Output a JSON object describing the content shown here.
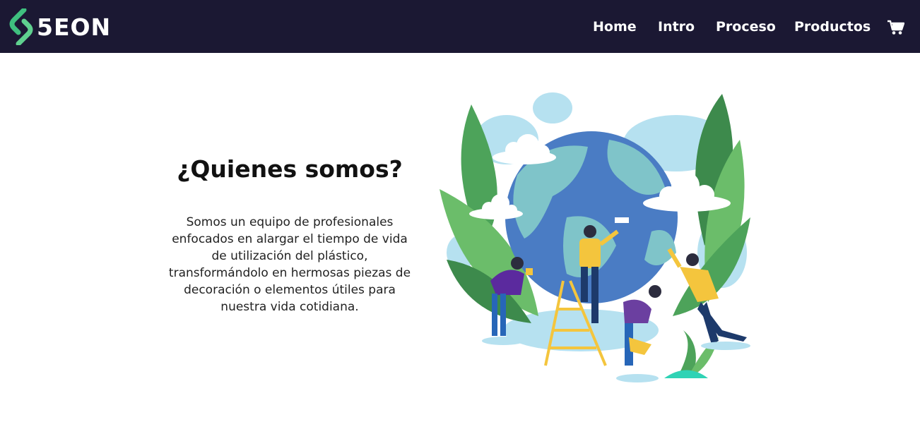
{
  "brand": {
    "name": "5EON",
    "icon": "leaf-s-logo-icon"
  },
  "nav": {
    "items": [
      "Home",
      "Intro",
      "Proceso",
      "Productos"
    ],
    "cart_icon": "shopping-cart-icon"
  },
  "hero": {
    "title": "¿Quienes somos?",
    "description": "Somos un equipo de profesionales enfocados en alargar el tiempo de vida de utilización del plástico, transformándolo en hermosas piezas de decoración o elementos útiles para nuestra vida cotidiana.",
    "illustration_icon": "people-caring-for-earth-illustration"
  },
  "colors": {
    "nav_bg": "#1b1833",
    "logo_green": "#3fbf7f",
    "earth_blue": "#4a7cc4",
    "earth_teal": "#7fc4c9",
    "leaf_green": "#4da35a",
    "sky_blue": "#b6e1f0"
  }
}
